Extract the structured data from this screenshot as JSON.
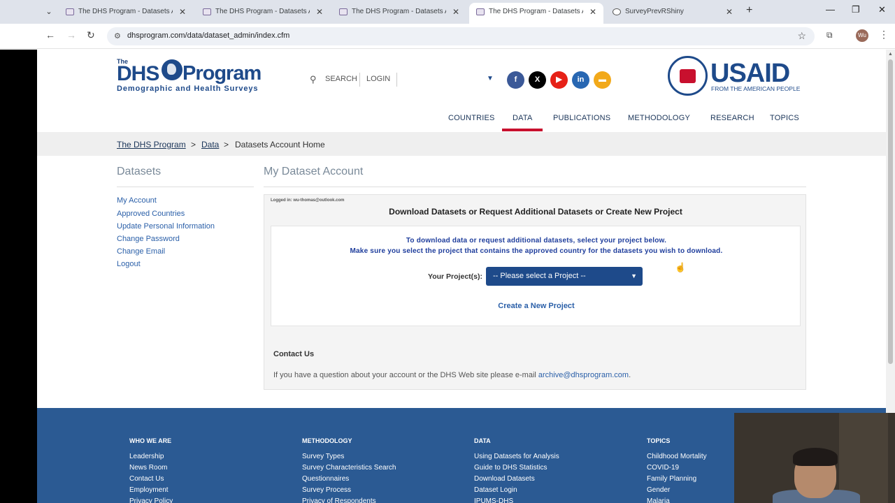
{
  "browser": {
    "tabs": [
      {
        "title": "The DHS Program - Datasets Ac",
        "active": false
      },
      {
        "title": "The DHS Program - Datasets Ac",
        "active": false
      },
      {
        "title": "The DHS Program - Datasets Ac",
        "active": false
      },
      {
        "title": "The DHS Program - Datasets Ac",
        "active": true
      },
      {
        "title": "SurveyPrevRShiny",
        "active": false
      }
    ],
    "url": "dhsprogram.com/data/dataset_admin/index.cfm",
    "profile_initials": "Wu"
  },
  "header": {
    "logo_the": "The",
    "logo_dhs": "DHS",
    "logo_program": "Program",
    "logo_tagline": "Demographic and Health Surveys",
    "search_label": "SEARCH",
    "login_label": "LOGIN",
    "social": [
      {
        "icon": "facebook-icon",
        "glyph": "f",
        "color": "#3b5998"
      },
      {
        "icon": "x-icon",
        "glyph": "X",
        "color": "#000000"
      },
      {
        "icon": "youtube-icon",
        "glyph": "▶",
        "color": "#e62117"
      },
      {
        "icon": "linkedin-icon",
        "glyph": "in",
        "color": "#2867b2"
      },
      {
        "icon": "chat-icon",
        "glyph": "▬",
        "color": "#f2a91a"
      }
    ],
    "usaid_word": "USAID",
    "usaid_tagline": "FROM THE AMERICAN PEOPLE"
  },
  "nav": {
    "items": [
      "COUNTRIES",
      "DATA",
      "PUBLICATIONS",
      "METHODOLOGY",
      "RESEARCH",
      "TOPICS"
    ],
    "active": "DATA",
    "active_color": "#c8102e"
  },
  "breadcrumb": {
    "items": [
      "The DHS Program",
      "Data",
      "Datasets Account Home"
    ],
    "separator": ">"
  },
  "sidebar": {
    "title": "Datasets",
    "links": [
      "My Account",
      "Approved Countries",
      "Update Personal Information",
      "Change Password",
      "Change Email",
      "Logout"
    ]
  },
  "main": {
    "title": "My Dataset Account",
    "logged_in": "Logged in: wu-thomas@outlook.com",
    "heading": "Download Datasets or Request Additional Datasets or Create New Project",
    "instruction_1": "To download data or request additional datasets, select your project below.",
    "instruction_2": "Make sure you select the project that contains the approved country for the datasets you wish to download.",
    "project_label": "Your Project(s):",
    "project_select_value": "-- Please select a Project --",
    "create_project": "Create a New Project",
    "contact_heading": "Contact Us",
    "contact_text": "If you have a question about your account or the DHS Web site please e-mail",
    "contact_email": "archive@dhsprogram.com",
    "contact_end": "."
  },
  "footer": {
    "columns": [
      {
        "heading": "WHO WE ARE",
        "items": [
          "Leadership",
          "News Room",
          "Contact Us",
          "Employment",
          "Privacy Policy"
        ]
      },
      {
        "heading": "METHODOLOGY",
        "items": [
          "Survey Types",
          "Survey Characteristics Search",
          "Questionnaires",
          "Survey Process",
          "Privacy of Respondents"
        ]
      },
      {
        "heading": "DATA",
        "items": [
          "Using Datasets for Analysis",
          "Guide to DHS Statistics",
          "Download Datasets",
          "Dataset Login",
          "IPUMS-DHS"
        ]
      },
      {
        "heading": "TOPICS",
        "items": [
          "Childhood Mortality",
          "COVID-19",
          "Family Planning",
          "Gender",
          "Malaria"
        ]
      }
    ],
    "background": "#2b5a93"
  }
}
